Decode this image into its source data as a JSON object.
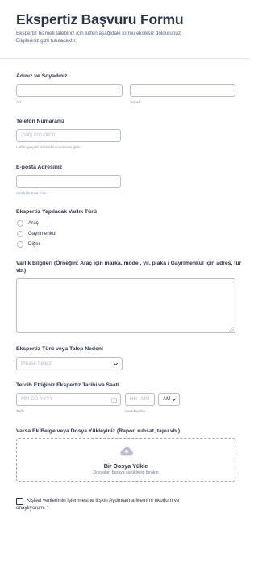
{
  "header": {
    "title": "Ekspertiz Başvuru Formu",
    "subtitle_line1": "Ekspertiz hizmeti talebiniz için lütfen aşağıdaki formu eksiksiz doldurunuz.",
    "subtitle_line2": "Bilgileriniz gizli tutulacaktır."
  },
  "name": {
    "label": "Adınız ve Soyadınız",
    "first_sub": "Ad",
    "last_sub": "Soyad",
    "first_value": "",
    "last_value": ""
  },
  "phone": {
    "label": "Telefon Numaranız",
    "placeholder": "(000) 000-0000",
    "hint": "Lütfen geçerli bir telefon numarası girin."
  },
  "email": {
    "label": "E-posta Adresiniz",
    "value": "",
    "hint": "ornek@ornek.com"
  },
  "asset_type": {
    "label": "Ekspertiz Yapılacak Varlık Türü",
    "options": [
      "Araç",
      "Gayrimenkul",
      "Diğer"
    ]
  },
  "asset_info": {
    "label_line1": "Varlık Bilgileri (Örneğin: Araç için marka, model, yıl, plaka / Gayrimenkul için adres, tür",
    "label_line2": "vb.)",
    "value": ""
  },
  "reason": {
    "label": "Ekspertiz Türü veya Talep Nedeni",
    "selected": "Please Select"
  },
  "datetime": {
    "label": "Tercih Ettiğiniz Ekspertiz Tarihi ve Saati",
    "date_placeholder": "MM-DD-YYYY",
    "time_placeholder": "HH : MM",
    "ampm": "AM",
    "date_sub": "Tarih",
    "time_sub": "Saat Dakika"
  },
  "upload": {
    "label": "Varsa Ek Belge veya Dosya Yükleyiniz (Rapor, ruhsat, tapu vb.)",
    "title": "Bir Dosya Yükle",
    "subtitle": "Dosyaları buraya sürükleyip bırakın"
  },
  "consent": {
    "line1": "Kişisel verilerimin işlenmesine ilişkin Aydınlatma Metni'ni okudum ve",
    "line2": "onaylıyorum.",
    "required_mark": "*",
    "checked": false
  },
  "colors": {
    "text": "#2c3345",
    "border": "#b8bdc9",
    "placeholder": "#b8bdc9",
    "required": "#f23a3c"
  }
}
